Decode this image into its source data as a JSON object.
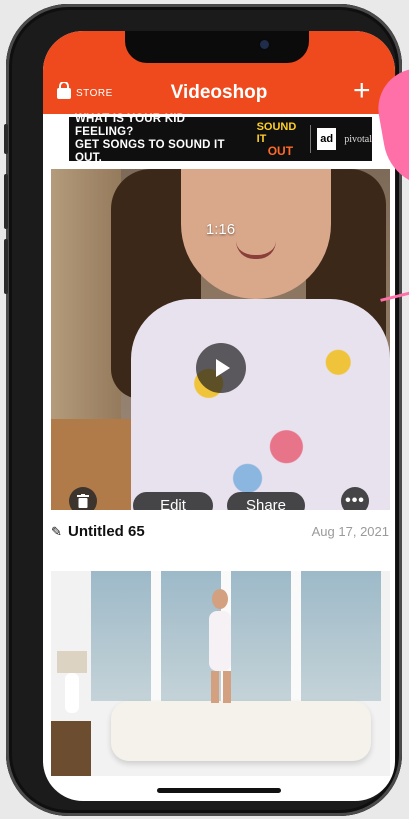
{
  "nav": {
    "store_label": "STORE",
    "title": "Videoshop",
    "add_symbol": "+"
  },
  "ad_banner": {
    "line1": "WHAT IS YOUR KID FEELING?",
    "line2": "GET SONGS TO SOUND IT OUT.",
    "logo_line1": "SOUND IT",
    "logo_line2": "OUT",
    "ad_mark": "ad",
    "partner": "pivotal"
  },
  "videos": [
    {
      "duration": "1:16",
      "title": "Untitled 65",
      "date": "Aug 17, 2021",
      "actions": {
        "edit_label": "Edit",
        "share_label": "Share",
        "more_label": "•••"
      }
    }
  ],
  "colors": {
    "nav_background": "#ef4a1d",
    "annotation": "#ff6fa8"
  },
  "icons": [
    "store-bag-icon",
    "trash-icon",
    "play-icon",
    "more-icon",
    "pencil-icon",
    "plus-icon"
  ]
}
